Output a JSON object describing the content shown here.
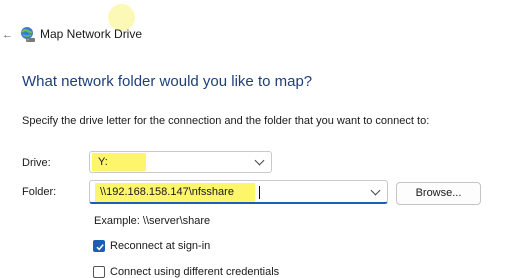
{
  "window": {
    "title": "Map Network Drive"
  },
  "heading": "What network folder would you like to map?",
  "instruction": "Specify the drive letter for the connection and the folder that you want to connect to:",
  "drive": {
    "label": "Drive:",
    "value": "Y:"
  },
  "folder": {
    "label": "Folder:",
    "value": "\\\\192.168.158.147\\nfsshare"
  },
  "browse_label": "Browse...",
  "example": "Example: \\\\server\\share",
  "options": {
    "reconnect": {
      "label": "Reconnect at sign-in",
      "checked": true
    },
    "different_credentials": {
      "label": "Connect using different credentials",
      "checked": false
    }
  },
  "icons": {
    "back": "back-arrow-icon",
    "title": "network-drive-icon"
  },
  "colors": {
    "heading": "#1f3f7a",
    "accent": "#1a5fb4",
    "highlight": "#fdf56a"
  }
}
